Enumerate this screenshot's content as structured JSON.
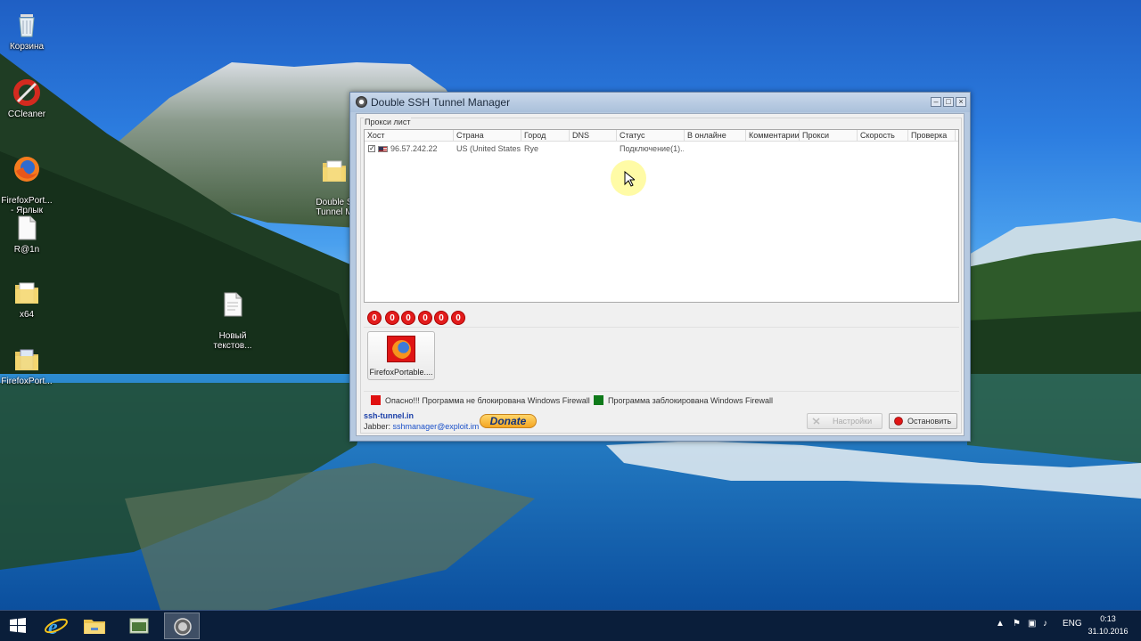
{
  "desktop": {
    "icons": [
      {
        "label": "Корзина",
        "icon": "recycle-bin-icon"
      },
      {
        "label": "CCleaner",
        "icon": "ccleaner-icon"
      },
      {
        "label": "FirefoxPort...\n- Ярлык",
        "icon": "firefox-icon"
      },
      {
        "label": "R@1n",
        "icon": "text-file-icon"
      },
      {
        "label": "x64",
        "icon": "folder-icon"
      },
      {
        "label": "FirefoxPort...",
        "icon": "folder-icon"
      },
      {
        "label": "Новый\nтекстов...",
        "icon": "text-file-icon"
      },
      {
        "label": "Double S\nTunnel M",
        "icon": "folder-icon"
      }
    ]
  },
  "window": {
    "title": "Double SSH Tunnel Manager",
    "group_label": "Прокси лист",
    "columns": [
      "Хост",
      "Страна",
      "Город",
      "DNS",
      "Статус",
      "В онлайне",
      "Комментарии",
      "Прокси",
      "Скорость",
      "Проверка"
    ],
    "rows": [
      {
        "checked": true,
        "host": "96.57.242.22",
        "country": "US (United States)",
        "city": "Rye",
        "dns": "",
        "status": "Подключение(1)...",
        "online": "",
        "comment": "",
        "proxy": "",
        "speed": "",
        "check": ""
      }
    ],
    "counters": [
      "0",
      "0",
      "0",
      "0",
      "0",
      "0"
    ],
    "apps": [
      {
        "label": "FirefoxPortable....",
        "icon": "firefox-icon"
      }
    ],
    "legend": {
      "danger_text": "Опасно!!! Программа не блокирована Windows Firewall",
      "danger_color": "#e01010",
      "ok_text": "Программа заблокирована Windows Firewall",
      "ok_color": "#0f7a1a"
    },
    "footer": {
      "site": "ssh-tunnel.in",
      "jabber_label": "Jabber:",
      "jabber_value": "sshmanager@exploit.im",
      "donate_label": "Donate",
      "settings_label": "Настройки",
      "stop_label": "Остановить"
    }
  },
  "taskbar": {
    "lang": "ENG",
    "time": "0:13",
    "date": "31.10.2016"
  }
}
